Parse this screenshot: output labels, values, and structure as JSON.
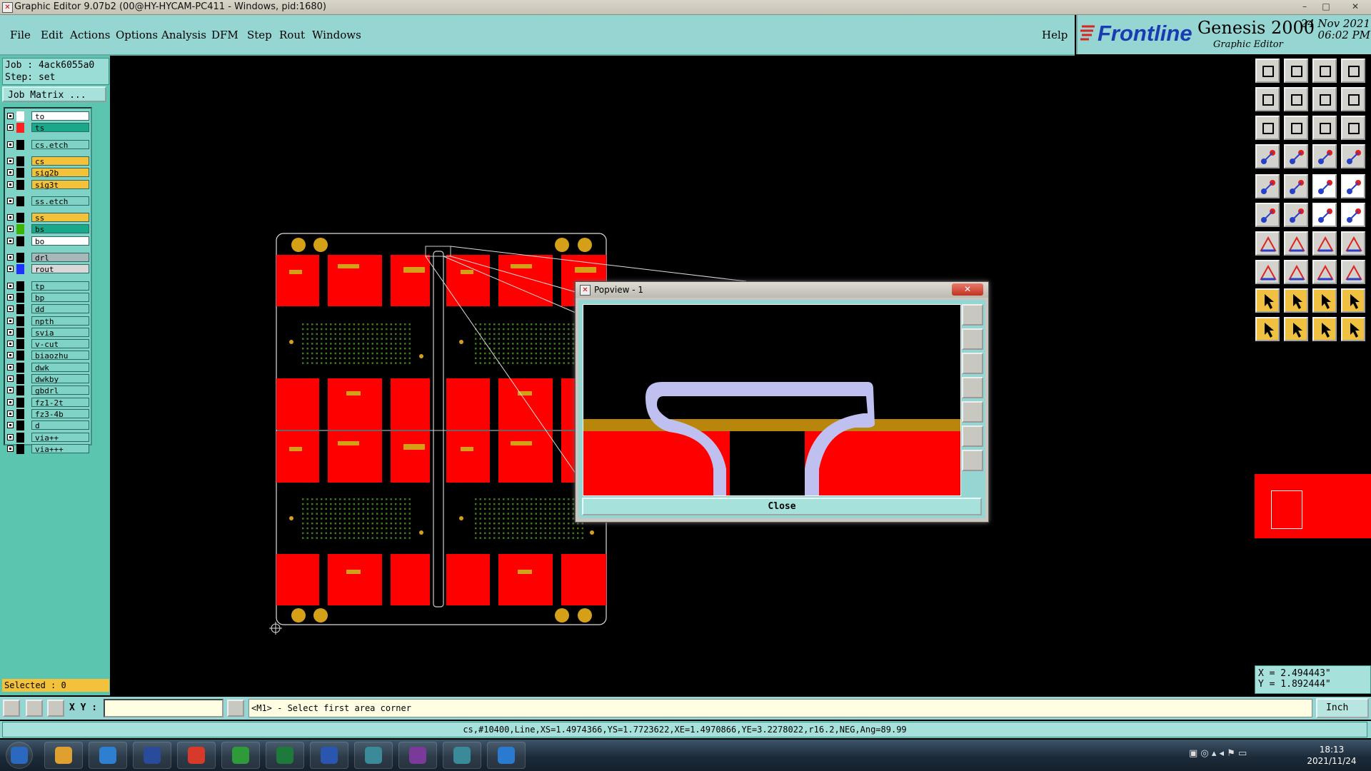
{
  "window": {
    "title": "Graphic Editor 9.07b2 (00@HY-HYCAM-PC411 - Windows, pid:1680)",
    "controls": [
      "–",
      "□",
      "✕"
    ]
  },
  "menu": {
    "items": [
      "File",
      "Edit",
      "Actions",
      "Options",
      "Analysis",
      "DFM",
      "Step",
      "Rout",
      "Windows"
    ],
    "help": "Help"
  },
  "brand": {
    "logo": "Frontline",
    "product": "Genesis 2000",
    "subtitle": "Graphic Editor",
    "date": "24 Nov 2021",
    "time": "06:02 PM"
  },
  "job": {
    "job_line": "Job : 4ack6055a0",
    "step_line": "Step: set",
    "matrix_button": "Job Matrix ..."
  },
  "layers": [
    {
      "name": "to",
      "color": "#ffffff",
      "bg": "#ffffff"
    },
    {
      "name": "ts",
      "color": "#ff2020",
      "bg": "#1aa88a",
      "active": true
    },
    {
      "name": "cs.etch",
      "color": "#000000",
      "bg": "#7fd3c6"
    },
    {
      "name": "cs",
      "color": "#000000",
      "bg": "#f3c23a"
    },
    {
      "name": "sig2b",
      "color": "#000000",
      "bg": "#f3c23a"
    },
    {
      "name": "sig3t",
      "color": "#000000",
      "bg": "#f3c23a"
    },
    {
      "name": "ss.etch",
      "color": "#000000",
      "bg": "#7fd3c6"
    },
    {
      "name": "ss",
      "color": "#000000",
      "bg": "#f3c23a"
    },
    {
      "name": "bs",
      "color": "#3cb400",
      "bg": "#1aa88a"
    },
    {
      "name": "bo",
      "color": "#000000",
      "bg": "#ffffff"
    },
    {
      "name": "drl",
      "color": "#000000",
      "bg": "#a8b8b8"
    },
    {
      "name": "rout",
      "color": "#1e32ff",
      "bg": "#d8d8d8"
    },
    {
      "name": "tp",
      "color": "#000000",
      "bg": "#7fd3c6"
    },
    {
      "name": "bp",
      "color": "#000000",
      "bg": "#7fd3c6"
    },
    {
      "name": "dd",
      "color": "#000000",
      "bg": "#7fd3c6"
    },
    {
      "name": "npth",
      "color": "#000000",
      "bg": "#7fd3c6"
    },
    {
      "name": "svia",
      "color": "#000000",
      "bg": "#7fd3c6"
    },
    {
      "name": "v-cut",
      "color": "#000000",
      "bg": "#7fd3c6"
    },
    {
      "name": "biaozhu",
      "color": "#000000",
      "bg": "#7fd3c6"
    },
    {
      "name": "dwk",
      "color": "#000000",
      "bg": "#7fd3c6"
    },
    {
      "name": "dwkby",
      "color": "#000000",
      "bg": "#7fd3c6"
    },
    {
      "name": "gbdrl",
      "color": "#000000",
      "bg": "#7fd3c6"
    },
    {
      "name": "fz1-2t",
      "color": "#000000",
      "bg": "#7fd3c6"
    },
    {
      "name": "fz3-4b",
      "color": "#000000",
      "bg": "#7fd3c6"
    },
    {
      "name": "d",
      "color": "#000000",
      "bg": "#7fd3c6"
    },
    {
      "name": "via++",
      "color": "#000000",
      "bg": "#7fd3c6"
    },
    {
      "name": "via+++",
      "color": "#000000",
      "bg": "#7fd3c6"
    }
  ],
  "selected_text": "Selected : 0",
  "coords": {
    "x_line": "X = 2.494443\"",
    "y_line": "Y = 1.892444\""
  },
  "command": {
    "xy_label": "X Y :",
    "xy_value": "",
    "prompt": "<M1> - Select first area corner",
    "unit": "Inch"
  },
  "status_line": "cs,#10400,Line,XS=1.4974366,YS=1.7723622,XE=1.4970866,YE=3.2278022,r16.2,NEG,Ang=89.99",
  "popview": {
    "title": "Popview - 1",
    "close_label": "Close"
  },
  "taskbar": {
    "time": "18:13",
    "date": "2021/11/24",
    "apps": [
      "start-orb",
      "paint-shell",
      "notepad",
      "save-disk",
      "red-app",
      "green-p",
      "excel",
      "word",
      "eye-app",
      "x-app",
      "eye-app-2",
      "messenger"
    ]
  },
  "colors": {
    "panel": "#96d6d2",
    "left_panel": "#5bc5b0",
    "copper": "#ff0000",
    "pad": "#d4a017",
    "trace": "#c0c0f0"
  }
}
